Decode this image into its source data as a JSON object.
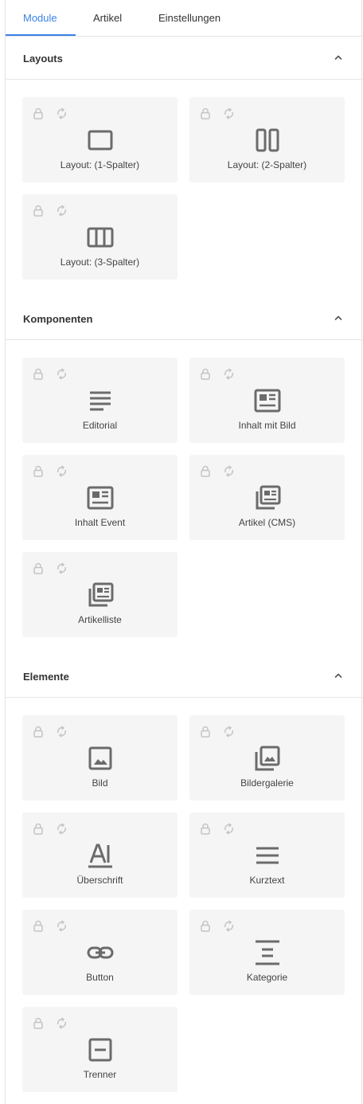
{
  "tabs": [
    {
      "label": "Module",
      "active": true
    },
    {
      "label": "Artikel",
      "active": false
    },
    {
      "label": "Einstellungen",
      "active": false
    }
  ],
  "colors": {
    "accent": "#3b82e6",
    "card_bg": "#f5f5f5",
    "icon": "#6b6b6b",
    "muted_icon": "#c4c4c4"
  },
  "sections": [
    {
      "title": "Layouts",
      "cards": [
        {
          "label": "Layout: (1-Spalter)",
          "icon": "layout-1-col-icon"
        },
        {
          "label": "Layout: (2-Spalter)",
          "icon": "layout-2-col-icon"
        },
        {
          "label": "Layout: (3-Spalter)",
          "icon": "layout-3-col-icon"
        }
      ]
    },
    {
      "title": "Komponenten",
      "cards": [
        {
          "label": "Editorial",
          "icon": "text-lines-icon"
        },
        {
          "label": "Inhalt mit Bild",
          "icon": "article-icon"
        },
        {
          "label": "Inhalt Event",
          "icon": "article-icon"
        },
        {
          "label": "Artikel (CMS)",
          "icon": "article-stack-icon"
        },
        {
          "label": "Artikelliste",
          "icon": "article-stack-icon"
        }
      ]
    },
    {
      "title": "Elemente",
      "cards": [
        {
          "label": "Bild",
          "icon": "image-icon"
        },
        {
          "label": "Bildergalerie",
          "icon": "gallery-icon"
        },
        {
          "label": "Überschrift",
          "icon": "heading-icon"
        },
        {
          "label": "Kurztext",
          "icon": "short-text-icon"
        },
        {
          "label": "Button",
          "icon": "link-icon"
        },
        {
          "label": "Kategorie",
          "icon": "category-icon"
        },
        {
          "label": "Trenner",
          "icon": "divider-icon"
        }
      ]
    }
  ]
}
